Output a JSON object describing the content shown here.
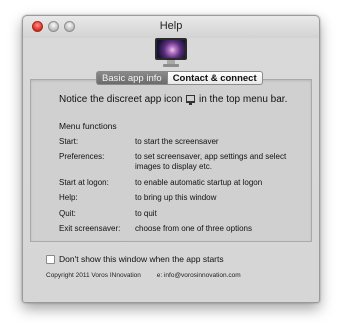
{
  "window": {
    "title": "Help"
  },
  "tabs": [
    {
      "label": "Basic app info"
    },
    {
      "label": "Contact & connect"
    }
  ],
  "notice": {
    "before": "Notice the discreet app icon",
    "after": "in the top menu bar."
  },
  "menu": {
    "heading": "Menu functions",
    "items": [
      {
        "key": "Start:",
        "value": "to start the screensaver"
      },
      {
        "key": "Preferences:",
        "value": "to set screensaver, app settings and select images to display etc."
      },
      {
        "key": "Start at logon:",
        "value": "to enable automatic startup at logon"
      },
      {
        "key": "Help:",
        "value": "to bring up this window"
      },
      {
        "key": "Quit:",
        "value": "to quit"
      },
      {
        "key": "Exit screensaver:",
        "value": "choose from one of three options"
      }
    ]
  },
  "checkbox": {
    "label": "Don't show this window when the app starts",
    "checked": false
  },
  "footer": {
    "copyright": "Copyright 2011 Voros INnovation",
    "email": "e: info@vorosinnovation.com"
  },
  "icons": {
    "app_icon": "monitor-icon",
    "menu_bar_icon": "monitor-icon"
  }
}
